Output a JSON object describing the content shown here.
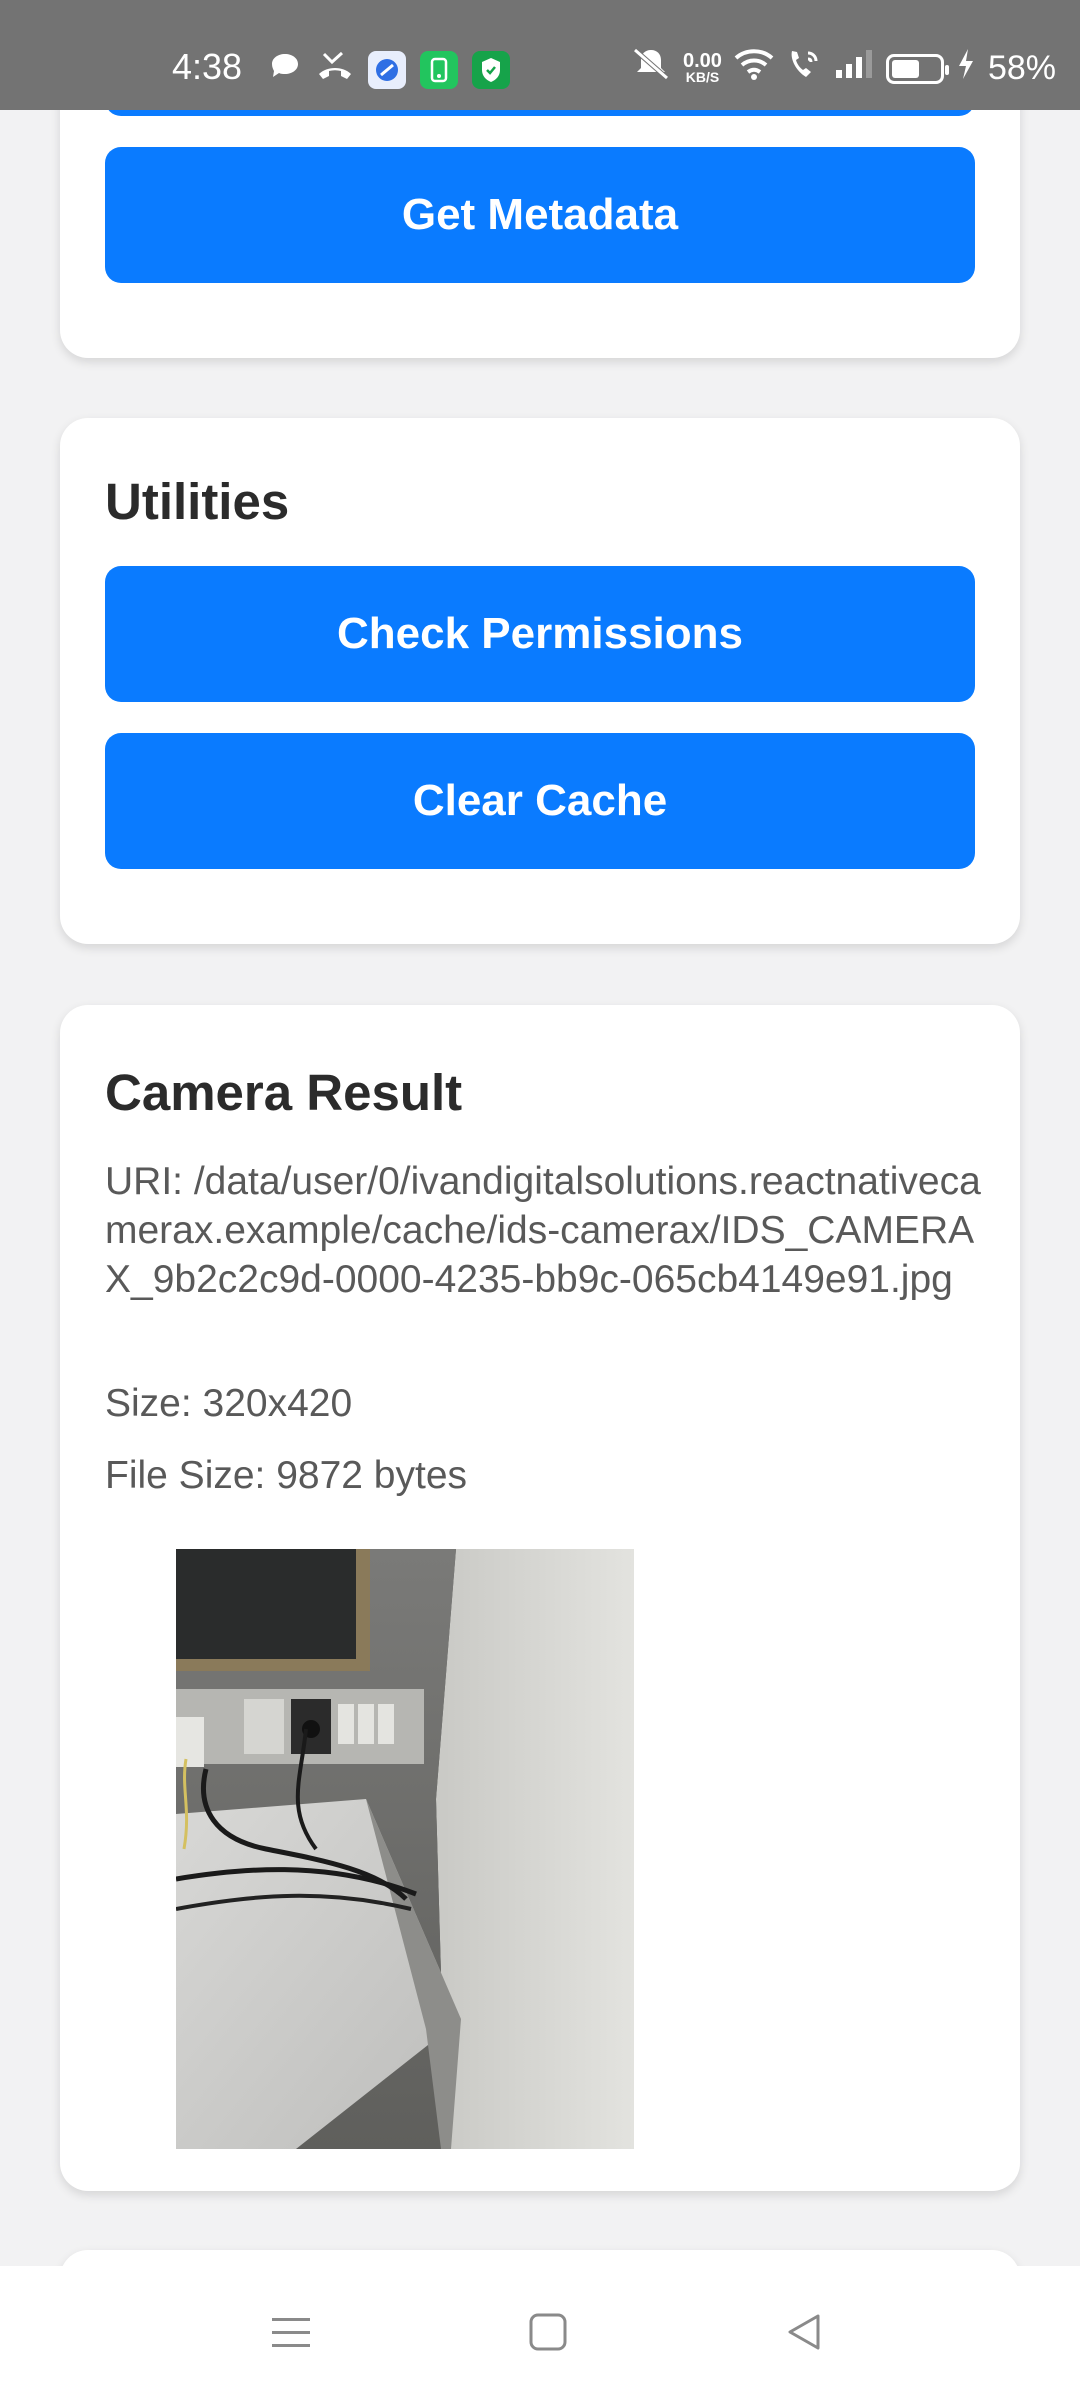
{
  "status_bar": {
    "time": "4:38",
    "net_speed_value": "0.00",
    "net_speed_unit": "KB/S",
    "battery_percent": "58%",
    "battery_level": 0.58,
    "icons": [
      "chat-bubble-icon",
      "missed-call-icon",
      "app-blue-icon",
      "app-green-icon",
      "shield-app-icon",
      "mute-icon",
      "wifi-icon",
      "wifi-call-icon",
      "signal-icon",
      "battery-icon",
      "charging-icon"
    ]
  },
  "cards": {
    "metadata": {
      "button_label": "Get Metadata"
    },
    "utilities": {
      "title": "Utilities",
      "check_permissions_label": "Check Permissions",
      "clear_cache_label": "Clear Cache"
    },
    "camera_result": {
      "title": "Camera Result",
      "uri": "URI: /data/user/0/ivandigitalsolutions.reactnativecamerax.example/cache/ids-camerax/IDS_CAMERAX_9b2c2c9d-0000-4235-bb9c-065cb4149e91.jpg",
      "size": "Size: 320x420",
      "file_size": "File Size: 9872 bytes"
    }
  },
  "nav_bar": {
    "icons": [
      "menu-icon",
      "home-icon",
      "back-icon"
    ]
  },
  "colors": {
    "accent": "#0a7bff",
    "background": "#f2f2f3",
    "status_bar": "#737373"
  }
}
